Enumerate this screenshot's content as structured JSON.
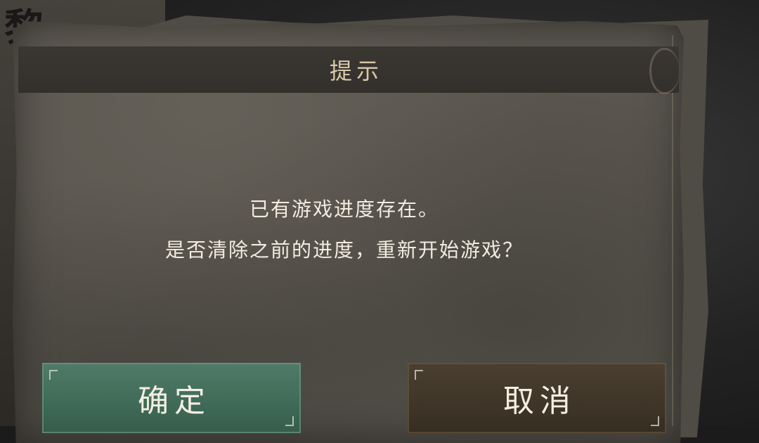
{
  "dialog": {
    "title": "提示",
    "message_line1": "已有游戏进度存在。",
    "message_line2": "是否清除之前的进度，重新开始游戏？"
  },
  "buttons": {
    "confirm_label": "确定",
    "cancel_label": "取消"
  },
  "background": {
    "calligraphy": "黎"
  },
  "colors": {
    "confirm_button": "#3f6a57",
    "cancel_button": "#3f3528",
    "title_text": "#d9c9a8",
    "message_text": "#f2ece0"
  }
}
